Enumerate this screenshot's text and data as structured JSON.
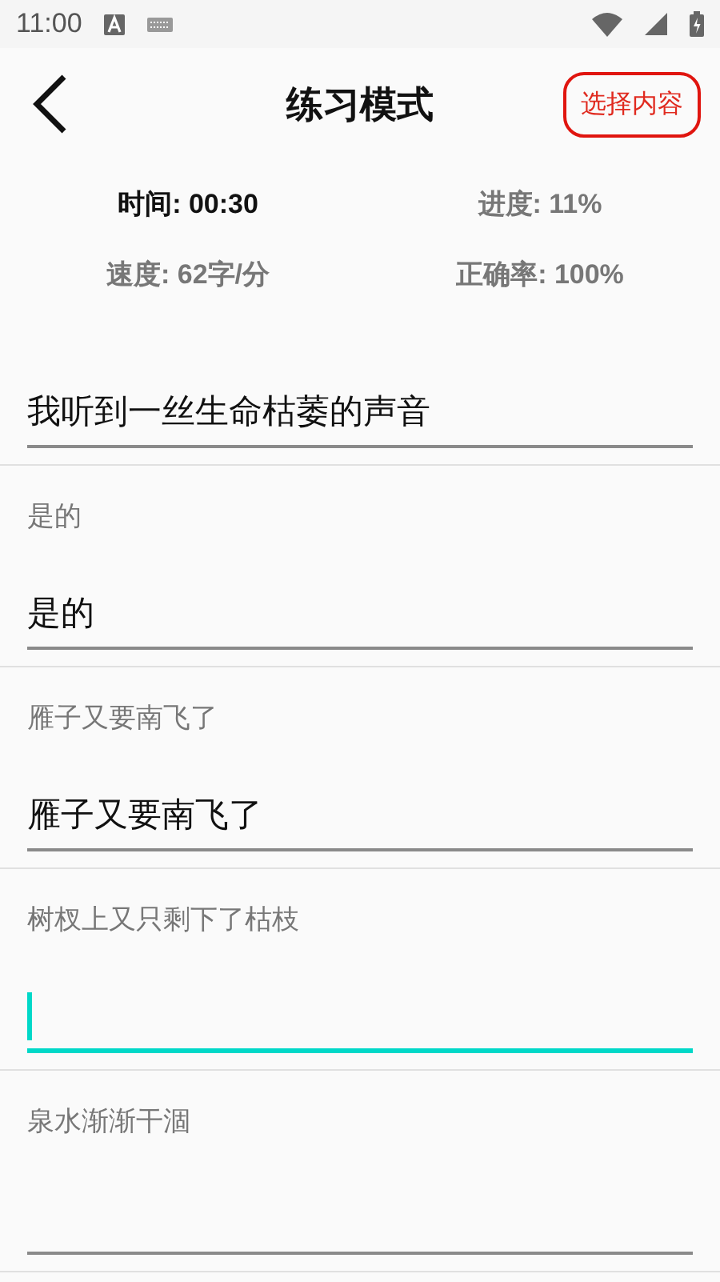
{
  "status_bar": {
    "time": "11:00"
  },
  "header": {
    "title": "练习模式",
    "action": "选择内容"
  },
  "stats": [
    {
      "text": "时间: 00:30",
      "highlighted": true
    },
    {
      "text": "进度: 11%",
      "highlighted": false
    },
    {
      "text": "速度: 62字/分",
      "highlighted": false
    },
    {
      "text": "正确率: 100%",
      "highlighted": false
    }
  ],
  "items": [
    {
      "value": "我听到一丝生命枯萎的声音",
      "focused": false
    },
    {
      "prompt": "是的",
      "value": "是的",
      "focused": false
    },
    {
      "prompt": "雁子又要南飞了",
      "value": "雁子又要南飞了",
      "focused": false
    },
    {
      "prompt": "树杈上又只剩下了枯枝",
      "focused": true
    },
    {
      "prompt": "泉水渐渐干涸",
      "focused": false
    }
  ]
}
